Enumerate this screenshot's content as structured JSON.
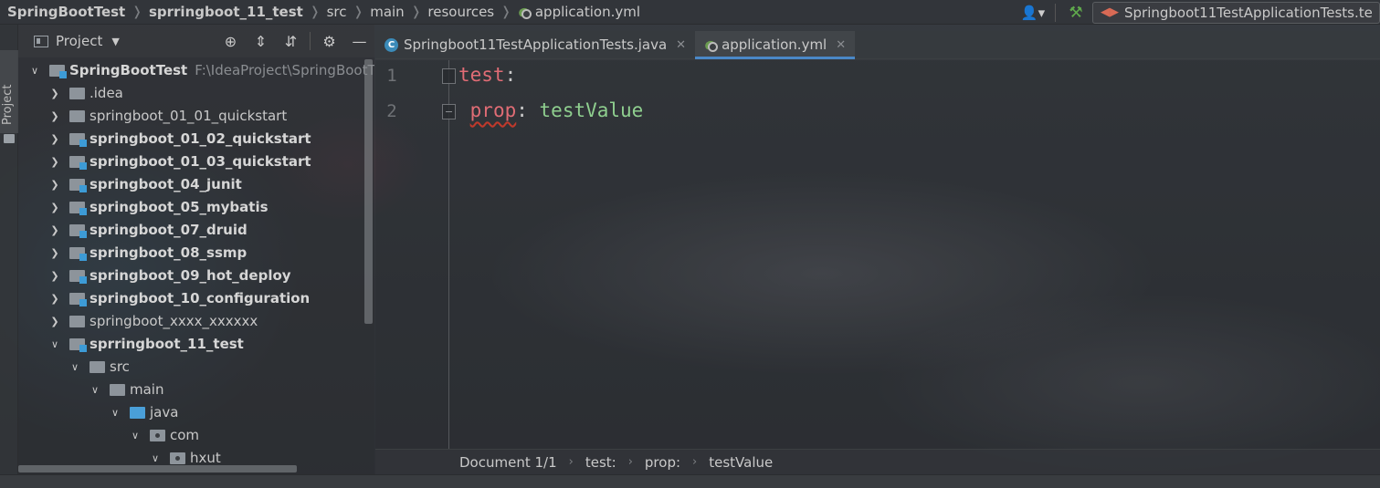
{
  "nav": {
    "crumbs": [
      {
        "label": "SpringBootTest",
        "bold": true
      },
      {
        "label": "sprringboot_11_test",
        "bold": true
      },
      {
        "label": "src"
      },
      {
        "label": "main"
      },
      {
        "label": "resources"
      },
      {
        "label": "application.yml",
        "icon": "yml-file-icon"
      }
    ],
    "run_config": "Springboot11TestApplicationTests.te"
  },
  "sidebar": {
    "tab_label": "Project"
  },
  "project_panel": {
    "title": "Project",
    "tree": [
      {
        "label": "SpringBootTest",
        "path": "F:\\IdeaProject\\SpringBootTest",
        "bold": true,
        "depth": 0,
        "expanded": true,
        "folder": "mod"
      },
      {
        "label": ".idea",
        "depth": 1,
        "expanded": false,
        "folder": "plain"
      },
      {
        "label": "springboot_01_01_quickstart",
        "depth": 1,
        "expanded": false,
        "folder": "plain"
      },
      {
        "label": "springboot_01_02_quickstart",
        "bold": true,
        "depth": 1,
        "expanded": false,
        "folder": "mod"
      },
      {
        "label": "springboot_01_03_quickstart",
        "bold": true,
        "depth": 1,
        "expanded": false,
        "folder": "mod"
      },
      {
        "label": "springboot_04_junit",
        "bold": true,
        "depth": 1,
        "expanded": false,
        "folder": "mod"
      },
      {
        "label": "springboot_05_mybatis",
        "bold": true,
        "depth": 1,
        "expanded": false,
        "folder": "mod"
      },
      {
        "label": "springboot_07_druid",
        "bold": true,
        "depth": 1,
        "expanded": false,
        "folder": "mod"
      },
      {
        "label": "springboot_08_ssmp",
        "bold": true,
        "depth": 1,
        "expanded": false,
        "folder": "mod"
      },
      {
        "label": "springboot_09_hot_deploy",
        "bold": true,
        "depth": 1,
        "expanded": false,
        "folder": "mod"
      },
      {
        "label": "springboot_10_configuration",
        "bold": true,
        "depth": 1,
        "expanded": false,
        "folder": "mod"
      },
      {
        "label": "springboot_xxxx_xxxxxx",
        "depth": 1,
        "expanded": false,
        "folder": "plain"
      },
      {
        "label": "sprringboot_11_test",
        "bold": true,
        "depth": 1,
        "expanded": true,
        "folder": "mod"
      },
      {
        "label": "src",
        "depth": 2,
        "expanded": true,
        "folder": "src"
      },
      {
        "label": "main",
        "depth": 3,
        "expanded": true,
        "folder": "plain"
      },
      {
        "label": "java",
        "depth": 4,
        "expanded": true,
        "folder": "java"
      },
      {
        "label": "com",
        "depth": 5,
        "expanded": true,
        "folder": "pkg"
      },
      {
        "label": "hxut",
        "depth": 6,
        "expanded": true,
        "folder": "pkg"
      }
    ]
  },
  "editor": {
    "tabs": [
      {
        "label": "Springboot11TestApplicationTests.java",
        "icon": "class-icon",
        "active": false
      },
      {
        "label": "application.yml",
        "icon": "yml-file-icon",
        "active": true
      }
    ],
    "lines": [
      {
        "number": "1",
        "key": "test",
        "colon": ":",
        "value": "",
        "indent": ""
      },
      {
        "number": "2",
        "key": "prop",
        "colon": ":",
        "value": " testValue",
        "indent": " "
      }
    ],
    "breadcrumb": [
      "Document 1/1",
      "test:",
      "prop:",
      "testValue"
    ]
  },
  "colors": {
    "key": "#e06c75",
    "value": "#8fcf8f",
    "accent": "#4a88c7",
    "build": "#5faa4c"
  }
}
